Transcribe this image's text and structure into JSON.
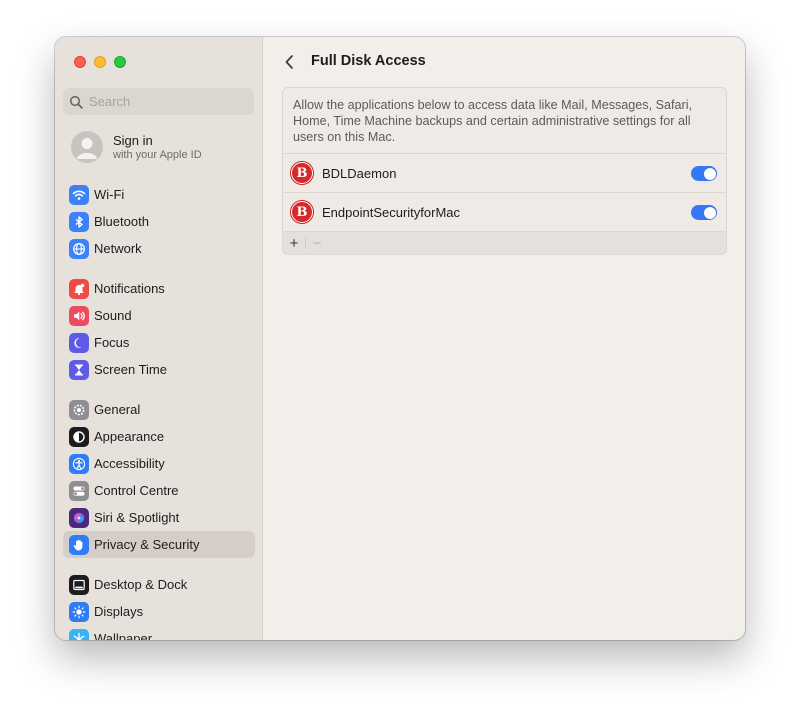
{
  "sidebar": {
    "search_placeholder": "Search",
    "signin": {
      "title": "Sign in",
      "subtitle": "with your Apple ID"
    },
    "groups": [
      [
        {
          "label": "Wi-Fi",
          "icon": "wifi-icon",
          "color": "#3b82f6"
        },
        {
          "label": "Bluetooth",
          "icon": "bluetooth-icon",
          "color": "#3b82f6"
        },
        {
          "label": "Network",
          "icon": "globe-icon",
          "color": "#3b82f6"
        }
      ],
      [
        {
          "label": "Notifications",
          "icon": "bell-icon",
          "color": "#f04a45"
        },
        {
          "label": "Sound",
          "icon": "speaker-icon",
          "color": "#f04a5e"
        },
        {
          "label": "Focus",
          "icon": "moon-icon",
          "color": "#5e5ce6"
        },
        {
          "label": "Screen Time",
          "icon": "hourglass-icon",
          "color": "#5e5ce6"
        }
      ],
      [
        {
          "label": "General",
          "icon": "gear-icon",
          "color": "#8e8e93"
        },
        {
          "label": "Appearance",
          "icon": "appearance-icon",
          "color": "#1c1c1e"
        },
        {
          "label": "Accessibility",
          "icon": "accessibility-icon",
          "color": "#2f7cf6"
        },
        {
          "label": "Control Centre",
          "icon": "switches-icon",
          "color": "#8e8e93"
        },
        {
          "label": "Siri & Spotlight",
          "icon": "siri-icon",
          "color": "#4a2a7a"
        },
        {
          "label": "Privacy & Security",
          "icon": "hand-icon",
          "color": "#2f7cf6",
          "selected": true
        }
      ],
      [
        {
          "label": "Desktop & Dock",
          "icon": "dock-icon",
          "color": "#1c1c1e"
        },
        {
          "label": "Displays",
          "icon": "sun-icon",
          "color": "#2f7cf6"
        },
        {
          "label": "Wallpaper",
          "icon": "snowflake-icon",
          "color": "#38b5f0"
        }
      ]
    ]
  },
  "main": {
    "title": "Full Disk Access",
    "description": "Allow the applications below to access data like Mail, Messages, Safari, Home, Time Machine backups and certain administrative settings for all users on this Mac.",
    "apps": [
      {
        "name": "BDLDaemon",
        "icon_letter": "B",
        "enabled": true
      },
      {
        "name": "EndpointSecurityforMac",
        "icon_letter": "B",
        "enabled": true
      }
    ],
    "add_label": "+",
    "remove_label": "−"
  },
  "colors": {
    "accent": "#3478f6",
    "app_icon": "#d8282a",
    "sidebar_bg": "#e7e1dc",
    "main_bg": "#f2eeea"
  }
}
